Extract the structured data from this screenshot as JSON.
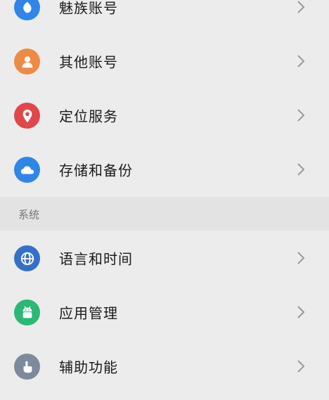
{
  "account_items": [
    {
      "label": "魅族账号",
      "icon": "meizu-account-icon",
      "color": "#2f86e8"
    },
    {
      "label": "其他账号",
      "icon": "user-icon",
      "color": "#ee8a48"
    },
    {
      "label": "定位服务",
      "icon": "location-pin-icon",
      "color": "#e0474a"
    },
    {
      "label": "存储和备份",
      "icon": "cloud-icon",
      "color": "#2f86e8"
    }
  ],
  "system_section": {
    "title": "系统"
  },
  "system_items": [
    {
      "label": "语言和时间",
      "icon": "globe-icon",
      "color": "#3470c9"
    },
    {
      "label": "应用管理",
      "icon": "android-icon",
      "color": "#2bb873"
    },
    {
      "label": "辅助功能",
      "icon": "hand-icon",
      "color": "#7c8a9c"
    }
  ],
  "chevron_icon": "chevron-right-icon"
}
